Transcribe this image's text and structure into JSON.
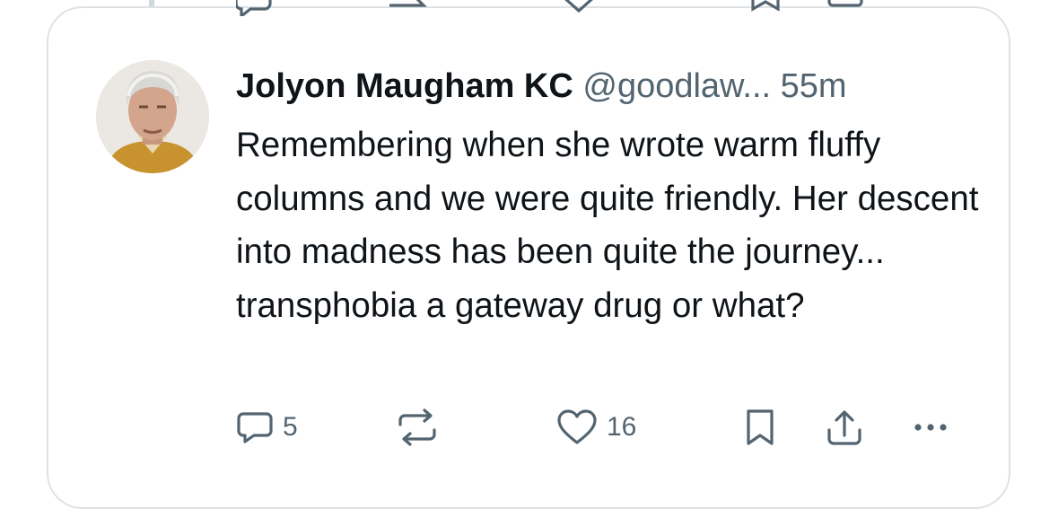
{
  "tweet": {
    "author_name": "Jolyon Maugham KC",
    "handle": "@goodlaw...",
    "time": "55m",
    "text": "Remembering when she wrote warm fluffy columns and we were quite friendly. Her descent into madness has been quite the journey... transphobia a gateway drug or what?",
    "avatar_icon": "profile-photo",
    "actions": {
      "reply_count": "5",
      "like_count": "16"
    }
  },
  "colors": {
    "text_primary": "#0f1419",
    "text_secondary": "#536471",
    "border": "#dde2e6"
  }
}
